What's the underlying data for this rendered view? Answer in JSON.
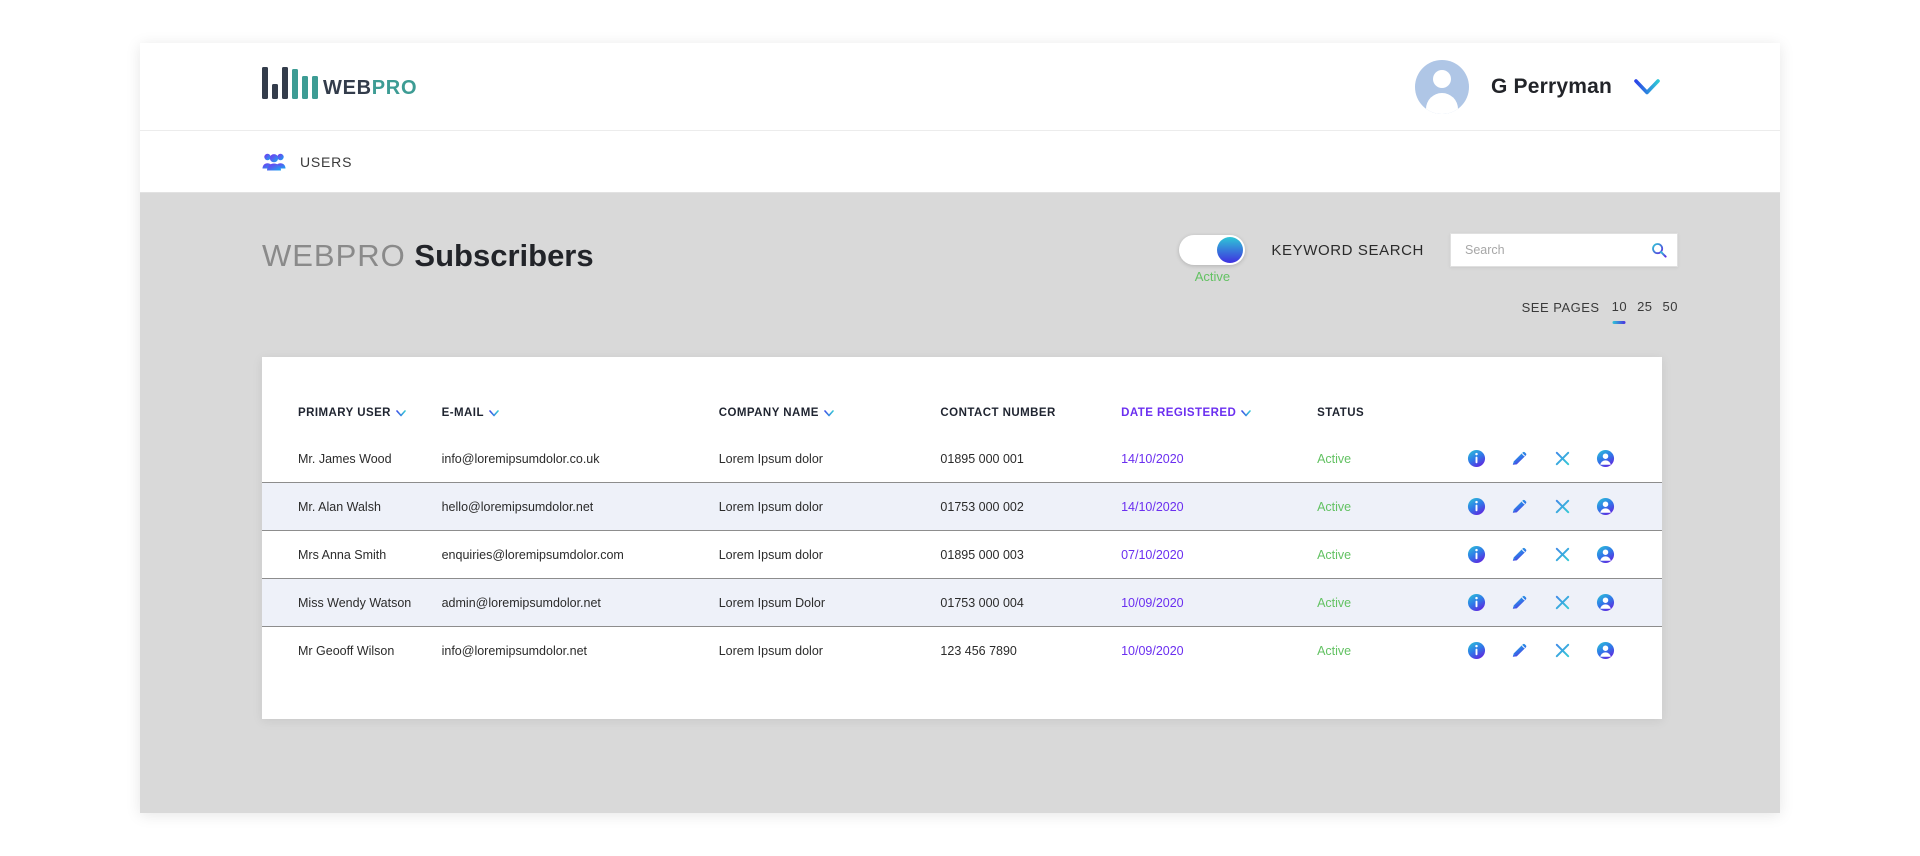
{
  "brand": {
    "logo_web": "WEB",
    "logo_pro": "PRO",
    "logo_icon": "bar-chart-logo-icon"
  },
  "header": {
    "user_name": "G Perryman",
    "avatar_icon": "user-avatar-icon",
    "dropdown_icon": "chevron-down-icon"
  },
  "nav": {
    "items": [
      {
        "label": "USERS",
        "icon": "users-group-icon"
      }
    ]
  },
  "page": {
    "title_light": "WEBPRO",
    "title_bold": "Subscribers"
  },
  "controls": {
    "toggle": {
      "state_label": "Active",
      "checked": true
    },
    "keyword_search_label": "KEYWORD SEARCH",
    "search": {
      "placeholder": "Search",
      "value": "",
      "icon": "search-icon"
    }
  },
  "pagination": {
    "label": "SEE PAGES",
    "options": [
      "10",
      "25",
      "50"
    ],
    "selected": "10"
  },
  "table": {
    "columns": [
      {
        "label": "PRIMARY USER",
        "sortable": true,
        "sorted": false
      },
      {
        "label": "E-MAIL",
        "sortable": true,
        "sorted": false
      },
      {
        "label": "COMPANY NAME",
        "sortable": true,
        "sorted": false
      },
      {
        "label": "CONTACT NUMBER",
        "sortable": false,
        "sorted": false
      },
      {
        "label": "DATE REGISTERED",
        "sortable": true,
        "sorted": true
      },
      {
        "label": "STATUS",
        "sortable": false,
        "sorted": false
      }
    ],
    "row_actions": [
      {
        "name": "info-icon",
        "title": "Info"
      },
      {
        "name": "edit-icon",
        "title": "Edit"
      },
      {
        "name": "close-icon",
        "title": "Delete"
      },
      {
        "name": "person-icon",
        "title": "Account"
      }
    ],
    "rows": [
      {
        "primary_user": "Mr. James Wood",
        "email": "info@loremipsumdolor.co.uk",
        "company": "Lorem Ipsum dolor",
        "contact": "01895 000 001",
        "date": "14/10/2020",
        "status": "Active"
      },
      {
        "primary_user": "Mr. Alan Walsh",
        "email": "hello@loremipsumdolor.net",
        "company": "Lorem Ipsum dolor",
        "contact": "01753 000 002",
        "date": "14/10/2020",
        "status": "Active"
      },
      {
        "primary_user": "Mrs Anna Smith",
        "email": "enquiries@loremipsumdolor.com",
        "company": "Lorem Ipsum dolor",
        "contact": "01895 000 003",
        "date": "07/10/2020",
        "status": "Active"
      },
      {
        "primary_user": "Miss Wendy Watson",
        "email": "admin@loremipsumdolor.net",
        "company": "Lorem Ipsum Dolor",
        "contact": "01753 000 004",
        "date": "10/09/2020",
        "status": "Active"
      },
      {
        "primary_user": "Mr Geooff Wilson",
        "email": "info@loremipsumdolor.net",
        "company": "Lorem Ipsum dolor",
        "contact": "123 456 7890",
        "date": "10/09/2020",
        "status": "Active"
      }
    ]
  },
  "colors": {
    "logo_dark": "#333c4b",
    "logo_teal": "#3d9c94",
    "accent_purple": "#6b2ff0",
    "accent_cyan": "#2ec7d6",
    "status_green": "#63c263",
    "page_bg": "#d9d9d9",
    "alt_row": "#eef1f9"
  }
}
